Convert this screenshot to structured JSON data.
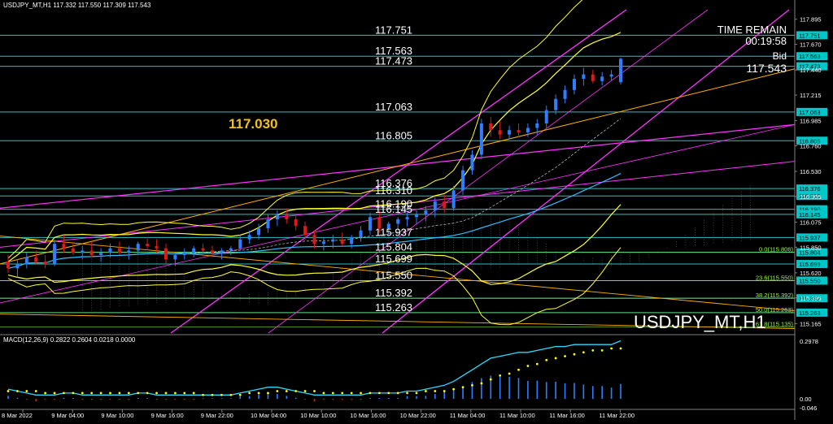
{
  "header": {
    "symbol_info": "USDJPY_MT,H1  117.332 117.550 117.309 117.543"
  },
  "info_panel": {
    "time_remain_label": "TIME REMAIN",
    "time_remain_value": "00:19:58",
    "bid_label": "Bid",
    "bid_value": "117.543",
    "watermark": "USDJPY_MT,H1",
    "big_label": "117.030"
  },
  "macd": {
    "label": "MACD(12,26,9) 0.2822 0.2604 0.0218 0.0000",
    "scale_top": "0.2978",
    "scale_zero": "0.00",
    "scale_bottom": "-0.046"
  },
  "colors": {
    "background": "#000000",
    "hline": "#2fbfbf",
    "bull_candle": "#2e7fff",
    "bear_candle": "#e01818",
    "bollinger": "#ffff33",
    "magenta": "#ff33ff",
    "orange": "#ffb000",
    "fib_line": "#9aff3a",
    "price_box": "#00c8c8",
    "macd_main": "#2fd8ff",
    "macd_signal": "#ffff00"
  },
  "chart_data": {
    "type": "candlestick",
    "price_axis": {
      "range": [
        115.08,
        117.98
      ],
      "ticks": [
        "117.895",
        "117.670",
        "117.440",
        "117.215",
        "116.985",
        "116.760",
        "116.530",
        "116.305",
        "116.075",
        "115.850",
        "115.620",
        "115.395",
        "115.165"
      ]
    },
    "x_labels": [
      "8 Mar 2022",
      "9 Mar 04:00",
      "9 Mar 10:00",
      "9 Mar 16:00",
      "9 Mar 22:00",
      "10 Mar 04:00",
      "10 Mar 10:00",
      "10 Mar 16:00",
      "10 Mar 22:00",
      "11 Mar 04:00",
      "11 Mar 10:00",
      "11 Mar 16:00",
      "11 Mar 22:00"
    ],
    "levels": [
      {
        "value": 117.751,
        "label": "117.751",
        "box": "117.751"
      },
      {
        "value": 117.563,
        "label": "117.563",
        "box": "117.563"
      },
      {
        "value": 117.473,
        "label": "117.473",
        "box": "117.473"
      },
      {
        "value": 117.063,
        "label": "117.063",
        "box": "117.063"
      },
      {
        "value": 116.805,
        "label": "116.805",
        "box": "116.805"
      },
      {
        "value": 116.376,
        "label": "116.376",
        "box": "116.376"
      },
      {
        "value": 116.31,
        "label": "116.310",
        "box": "116.310"
      },
      {
        "value": 116.19,
        "label": "116.190",
        "box": "116.190"
      },
      {
        "value": 116.145,
        "label": "116.145",
        "box": "116.145"
      },
      {
        "value": 115.937,
        "label": "115.937",
        "box": "115.937"
      },
      {
        "value": 115.804,
        "label": "115.804",
        "box": "115.804"
      },
      {
        "value": 115.699,
        "label": "115.699",
        "box": "115.699"
      },
      {
        "value": 115.55,
        "label": "115.550",
        "box": "115.550"
      },
      {
        "value": 115.392,
        "label": "115.392",
        "box": "115.392"
      },
      {
        "value": 115.263,
        "label": "115.263",
        "box": "115.263"
      }
    ],
    "fib_levels": [
      {
        "value": 115.806,
        "label": "0.0(115.806)"
      },
      {
        "value": 115.55,
        "label": "23.6(115.550)"
      },
      {
        "value": 115.392,
        "label": "38.2(115.392)"
      },
      {
        "value": 115.263,
        "label": "50.0(115.263)"
      },
      {
        "value": 115.135,
        "label": "61.8(115.135)"
      }
    ],
    "candles": [
      [
        115.72,
        115.78,
        115.62,
        115.66
      ],
      [
        115.66,
        115.74,
        115.58,
        115.7
      ],
      [
        115.7,
        115.8,
        115.66,
        115.76
      ],
      [
        115.76,
        115.82,
        115.7,
        115.72
      ],
      [
        115.72,
        115.78,
        115.66,
        115.7
      ],
      [
        115.7,
        115.92,
        115.68,
        115.88
      ],
      [
        115.88,
        115.96,
        115.8,
        115.84
      ],
      [
        115.84,
        115.9,
        115.78,
        115.8
      ],
      [
        115.8,
        115.86,
        115.74,
        115.82
      ],
      [
        115.82,
        115.9,
        115.76,
        115.78
      ],
      [
        115.78,
        115.84,
        115.72,
        115.8
      ],
      [
        115.8,
        115.88,
        115.76,
        115.84
      ],
      [
        115.84,
        115.9,
        115.78,
        115.8
      ],
      [
        115.8,
        115.86,
        115.74,
        115.82
      ],
      [
        115.82,
        115.9,
        115.78,
        115.88
      ],
      [
        115.88,
        115.94,
        115.82,
        115.86
      ],
      [
        115.86,
        115.92,
        115.8,
        115.84
      ],
      [
        115.84,
        115.88,
        115.7,
        115.74
      ],
      [
        115.74,
        115.8,
        115.68,
        115.78
      ],
      [
        115.78,
        115.84,
        115.74,
        115.8
      ],
      [
        115.8,
        115.86,
        115.76,
        115.84
      ],
      [
        115.84,
        115.88,
        115.78,
        115.82
      ],
      [
        115.82,
        115.86,
        115.76,
        115.8
      ],
      [
        115.8,
        115.84,
        115.74,
        115.82
      ],
      [
        115.82,
        115.86,
        115.78,
        115.84
      ],
      [
        115.84,
        115.96,
        115.82,
        115.92
      ],
      [
        115.92,
        116.0,
        115.88,
        115.96
      ],
      [
        115.96,
        116.06,
        115.92,
        116.02
      ],
      [
        116.02,
        116.14,
        115.98,
        116.1
      ],
      [
        116.1,
        116.18,
        116.04,
        116.14
      ],
      [
        116.14,
        116.2,
        116.06,
        116.1
      ],
      [
        116.1,
        116.14,
        116.0,
        116.04
      ],
      [
        116.04,
        116.08,
        115.92,
        115.96
      ],
      [
        115.96,
        116.0,
        115.84,
        115.88
      ],
      [
        115.88,
        115.94,
        115.82,
        115.9
      ],
      [
        115.9,
        115.96,
        115.84,
        115.92
      ],
      [
        115.92,
        115.98,
        115.86,
        115.88
      ],
      [
        115.88,
        115.96,
        115.84,
        115.94
      ],
      [
        115.94,
        116.04,
        115.9,
        116.0
      ],
      [
        116.0,
        116.16,
        115.96,
        116.12
      ],
      [
        116.12,
        116.18,
        115.98,
        116.02
      ],
      [
        116.02,
        116.08,
        115.96,
        116.06
      ],
      [
        116.06,
        116.12,
        116.0,
        116.1
      ],
      [
        116.1,
        116.16,
        116.04,
        116.12
      ],
      [
        116.12,
        116.18,
        116.06,
        116.14
      ],
      [
        116.14,
        116.22,
        116.08,
        116.18
      ],
      [
        116.18,
        116.3,
        116.12,
        116.26
      ],
      [
        116.26,
        116.32,
        116.16,
        116.2
      ],
      [
        116.2,
        116.4,
        116.18,
        116.36
      ],
      [
        116.36,
        116.58,
        116.32,
        116.54
      ],
      [
        116.54,
        116.72,
        116.5,
        116.68
      ],
      [
        116.68,
        117.0,
        116.64,
        116.96
      ],
      [
        116.96,
        117.02,
        116.84,
        116.9
      ],
      [
        116.9,
        116.98,
        116.82,
        116.86
      ],
      [
        116.86,
        116.94,
        116.82,
        116.9
      ],
      [
        116.9,
        116.96,
        116.84,
        116.88
      ],
      [
        116.88,
        116.96,
        116.84,
        116.92
      ],
      [
        116.92,
        117.0,
        116.86,
        116.96
      ],
      [
        116.96,
        117.12,
        116.92,
        117.08
      ],
      [
        117.08,
        117.22,
        117.04,
        117.18
      ],
      [
        117.18,
        117.3,
        117.14,
        117.26
      ],
      [
        117.26,
        117.4,
        117.22,
        117.36
      ],
      [
        117.36,
        117.46,
        117.3,
        117.4
      ],
      [
        117.4,
        117.44,
        117.32,
        117.34
      ],
      [
        117.34,
        117.42,
        117.3,
        117.38
      ],
      [
        117.38,
        117.44,
        117.34,
        117.4
      ],
      [
        117.33,
        117.55,
        117.31,
        117.54
      ]
    ],
    "macd_main": [
      0.05,
      0.04,
      0.03,
      0.02,
      0.02,
      0.02,
      0.03,
      0.03,
      0.02,
      0.02,
      0.02,
      0.02,
      0.02,
      0.02,
      0.03,
      0.03,
      0.02,
      0.02,
      0.02,
      0.02,
      0.02,
      0.02,
      0.02,
      0.02,
      0.02,
      0.03,
      0.04,
      0.05,
      0.06,
      0.06,
      0.05,
      0.04,
      0.03,
      0.02,
      0.02,
      0.02,
      0.02,
      0.02,
      0.02,
      0.03,
      0.03,
      0.03,
      0.03,
      0.04,
      0.04,
      0.05,
      0.06,
      0.07,
      0.09,
      0.12,
      0.15,
      0.18,
      0.21,
      0.22,
      0.23,
      0.24,
      0.24,
      0.25,
      0.26,
      0.27,
      0.27,
      0.28,
      0.28,
      0.28,
      0.28,
      0.28,
      0.3
    ],
    "macd_signal": [
      0.04,
      0.04,
      0.04,
      0.04,
      0.03,
      0.03,
      0.03,
      0.03,
      0.03,
      0.03,
      0.03,
      0.03,
      0.03,
      0.03,
      0.03,
      0.03,
      0.03,
      0.03,
      0.03,
      0.03,
      0.03,
      0.02,
      0.02,
      0.02,
      0.02,
      0.02,
      0.03,
      0.03,
      0.03,
      0.04,
      0.04,
      0.04,
      0.04,
      0.04,
      0.03,
      0.03,
      0.03,
      0.03,
      0.03,
      0.03,
      0.03,
      0.03,
      0.03,
      0.03,
      0.03,
      0.04,
      0.04,
      0.04,
      0.05,
      0.06,
      0.07,
      0.08,
      0.1,
      0.12,
      0.13,
      0.15,
      0.17,
      0.18,
      0.2,
      0.21,
      0.22,
      0.23,
      0.24,
      0.25,
      0.25,
      0.26,
      0.26
    ]
  }
}
